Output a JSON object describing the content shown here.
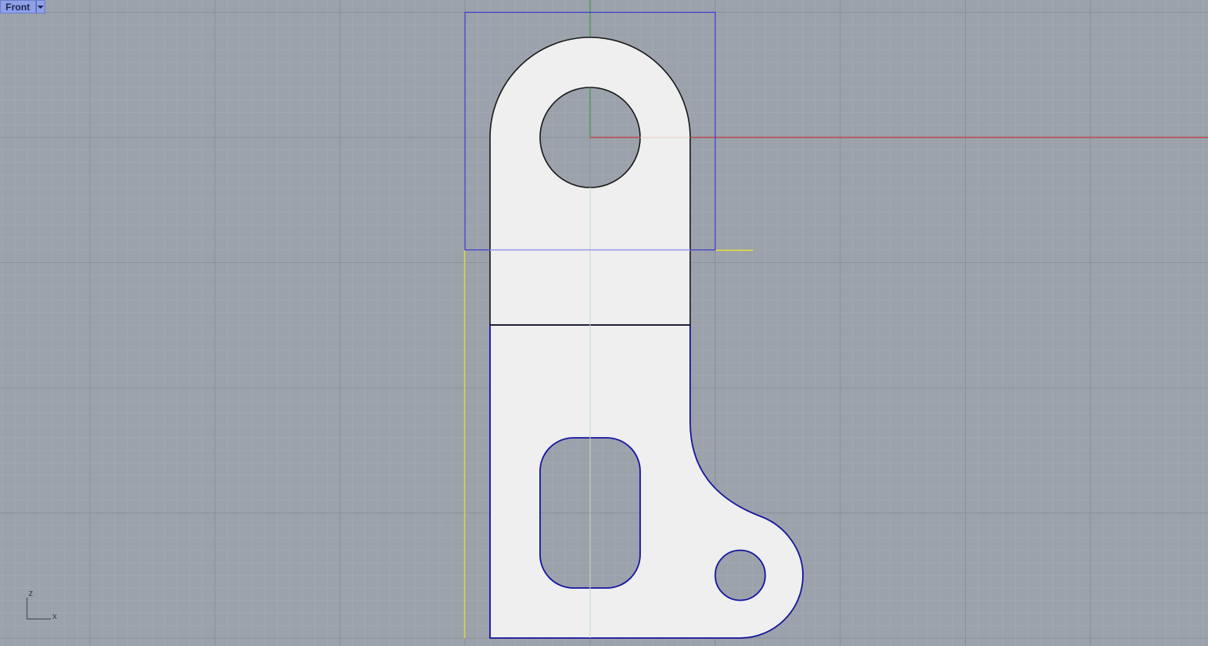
{
  "viewport": {
    "name": "Front",
    "dropdown_icon": "chevron-down-icon",
    "background_color": "#9ba2ab",
    "grid_minor_color": "#a3aab3",
    "grid_major_color": "#8b9199",
    "x_axis_color": "#b84a4f",
    "y_axis_color": "#3c9b3c",
    "bbox_color": "#3c3ccf",
    "guide_color": "#e4df3c",
    "curve_color": "#1a1a1a",
    "selected_curve_color": "#1616a0",
    "part_fill": "#eeefee"
  },
  "axis_indicator": {
    "vertical_label": "z",
    "horizontal_label": "x"
  }
}
